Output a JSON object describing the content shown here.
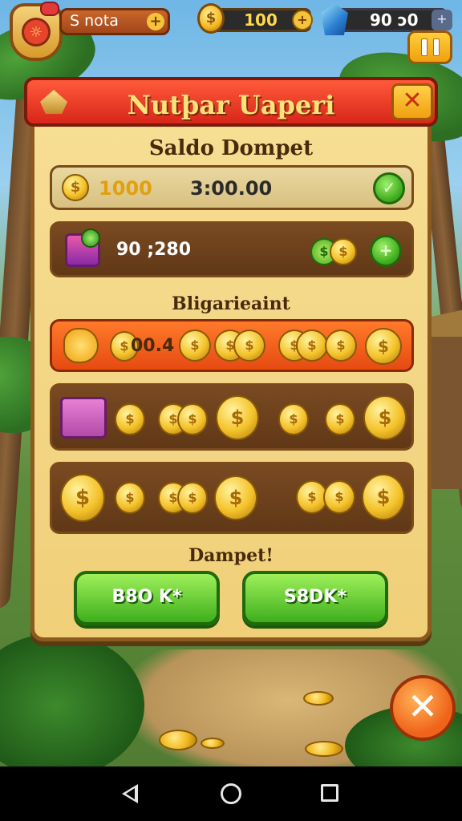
{
  "hud": {
    "player_name": "S nota",
    "name_plus": "+",
    "coins": "100",
    "coin_plus": "+",
    "gems": "90  ɔ0",
    "gem_plus": "+"
  },
  "dialog": {
    "title": "Nutþar Uaperi",
    "close_label": "✕",
    "wallet_heading": "Saldo Dompet",
    "wallet_rows": [
      {
        "amount": "1000",
        "value": "3:00.00",
        "action": "✓"
      },
      {
        "value": "90 ;280",
        "action": "+"
      }
    ],
    "packages_heading": "Bligarieaint",
    "featured_value": "00.4",
    "footer_heading": "Dampet!",
    "buttons": {
      "left": "B8O K*",
      "right": "S8DK*"
    }
  },
  "colors": {
    "panel": "#f0cf78",
    "title_bar": "#d8261a",
    "green_button": "#3fae1c",
    "coin": "#f4c22a"
  },
  "icons": {
    "shield": "shield-icon",
    "coin": "coin-icon",
    "gem": "gem-icon",
    "pause": "pause-icon",
    "close": "close-icon",
    "chest": "treasure-chest-icon"
  },
  "close_big": "✕"
}
